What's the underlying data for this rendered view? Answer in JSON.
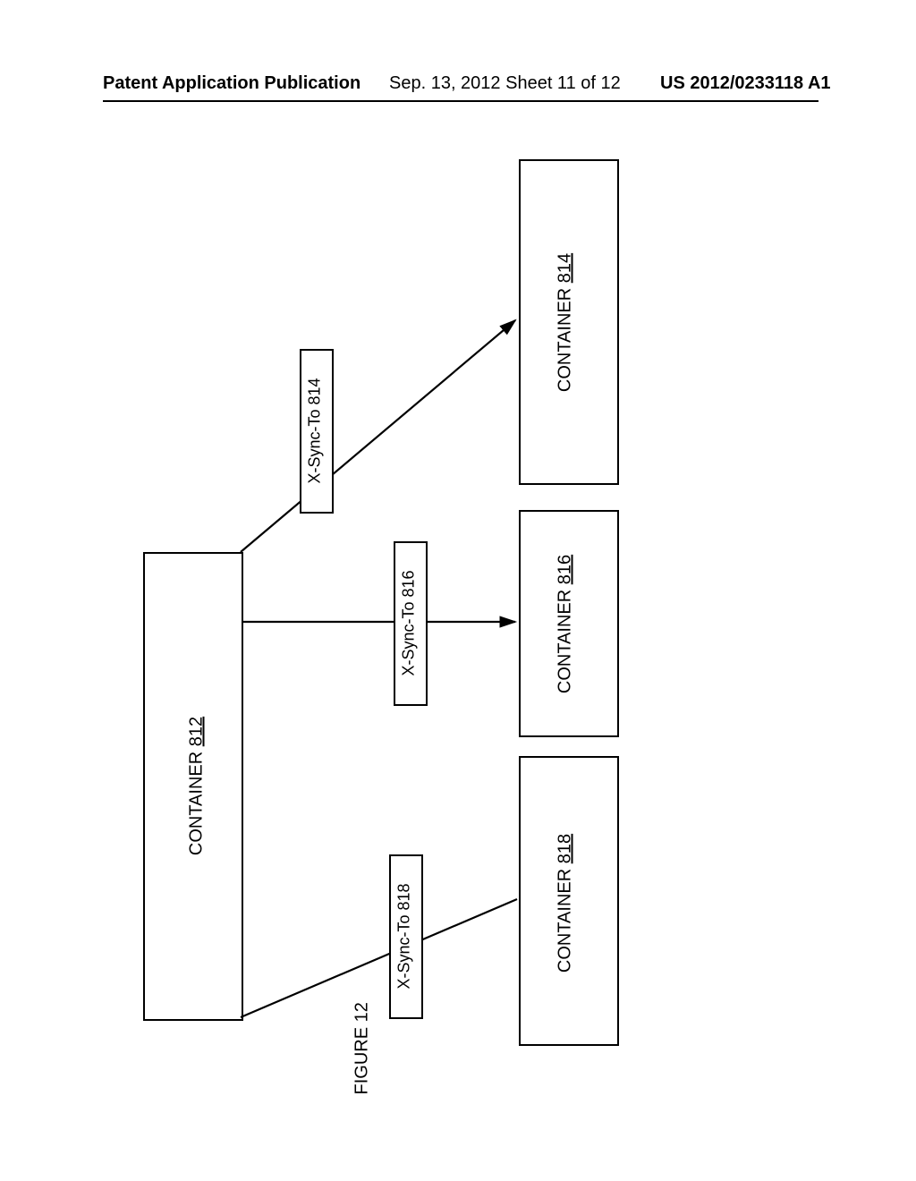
{
  "header": {
    "left": "Patent Application Publication",
    "mid": "Sep. 13, 2012  Sheet 11 of 12",
    "right": "US 2012/0233118 A1"
  },
  "boxes": {
    "c812_word": "CONTAINER ",
    "c812_num": "812",
    "c814_word": "CONTAINER ",
    "c814_num": "814",
    "c816_word": "CONTAINER ",
    "c816_num": "816",
    "c818_word": "CONTAINER ",
    "c818_num": "818"
  },
  "labels": {
    "s814": "X-Sync-To 814",
    "s816": "X-Sync-To 816",
    "s818": "X-Sync-To 818"
  },
  "figure_caption": "FIGURE 12"
}
